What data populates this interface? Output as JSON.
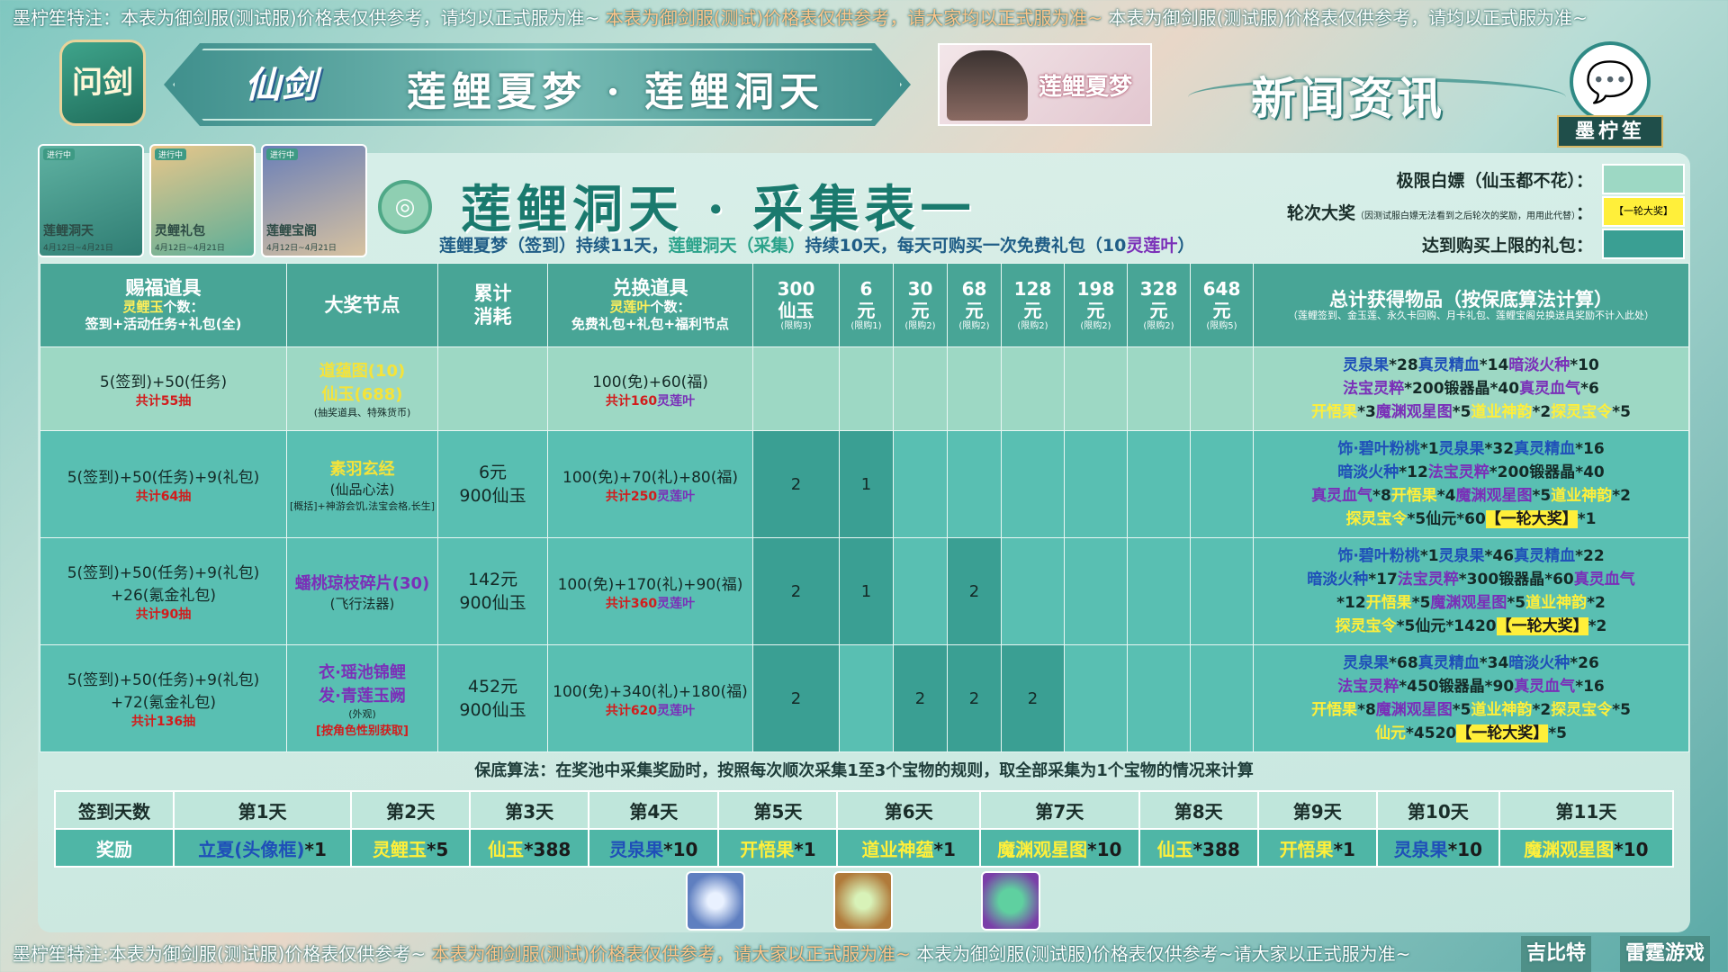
{
  "top_notice": {
    "part1": "墨柠笙特注：本表为御剑服(测试服)价格表仅供参考，请均以正式服为准~",
    "part2": "本表为御剑服(测试)价格表仅供参考，请大家均以正式服为准~",
    "part3": "本表为御剑服(测试服)价格表仅供参考，请均以正式服为准~"
  },
  "bottom_notice": {
    "part1": "墨柠笙特注:本表为御剑服(测试服)价格表仅供参考~",
    "part2": "本表为御剑服(测试)价格表仅供参考，请大家以正式服为准~",
    "part3": "本表为御剑服(测试服)价格表仅供参考~请大家以正式服为准~"
  },
  "header": {
    "game_logo": "问剑",
    "brand": "仙剑",
    "banner_title": "莲鲤夏梦 · 莲鲤洞天",
    "promo_text": "莲鲤夏梦",
    "news_title": "新闻资讯",
    "author_plate": "墨柠笙",
    "wechat_icon": "wechat-icon"
  },
  "cards": [
    {
      "tag": "进行中",
      "name": "莲鲤洞天",
      "date": "4月12日~4月21日"
    },
    {
      "tag": "进行中",
      "name": "灵鲤礼包",
      "date": "4月12日~4月21日"
    },
    {
      "tag": "进行中",
      "name": "莲鲤宝阁",
      "date": "4月12日~4月21日"
    }
  ],
  "sheet": {
    "title": "莲鲤洞天 · 采集表一",
    "subline_a": "莲鲤夏梦（签到）持续11天，",
    "subline_b": "莲鲤洞天（采集）",
    "subline_c": "持续10天，每天可购买一次免费礼包（10",
    "subline_d": "灵莲叶",
    "subline_e": "）"
  },
  "legend": [
    {
      "label": "极限白嫖（仙玉都不花）：",
      "note": "",
      "swatch_text": "",
      "color": "#9dd8c4"
    },
    {
      "label": "轮次大奖",
      "note": "（因测试服白嫖无法看到之后轮次的奖励，用用此代替）",
      "swatch_text": "【一轮大奖】",
      "color": "#ffef3a"
    },
    {
      "label": "达到购买上限的礼包：",
      "note": "",
      "swatch_text": "",
      "color": "#3a9f93"
    }
  ],
  "table": {
    "headers": {
      "c1": {
        "title": "赐福道具",
        "sub_y": "灵鲤玉",
        "sub": "个数：",
        "sub2": "签到+活动任务+礼包(全)"
      },
      "c2": "大奖节点",
      "c3a": "累计",
      "c3b": "消耗",
      "c4": {
        "title": "兑换道具",
        "sub_y": "灵莲叶",
        "sub": "个数：",
        "sub2": "免费礼包+礼包+福利节点"
      },
      "packs": [
        {
          "a": "300",
          "b": "仙玉",
          "c": "(限购3)"
        },
        {
          "a": "6",
          "b": "元",
          "c": "(限购1)"
        },
        {
          "a": "30",
          "b": "元",
          "c": "(限购2)"
        },
        {
          "a": "68",
          "b": "元",
          "c": "(限购2)"
        },
        {
          "a": "128",
          "b": "元",
          "c": "(限购2)"
        },
        {
          "a": "198",
          "b": "元",
          "c": "(限购2)"
        },
        {
          "a": "328",
          "b": "元",
          "c": "(限购2)"
        },
        {
          "a": "648",
          "b": "元",
          "c": "(限购5)"
        }
      ],
      "total_title": "总计获得物品（按保底算法计算）",
      "total_note": "（莲鲤签到、金玉莲、永久卡回购、月卡礼包、莲鲤宝阁兑换送具奖励不计入此处）"
    },
    "rows": [
      {
        "c1": "5(签到)+50(任务)",
        "c1b": "",
        "c1_total": "共计55抽",
        "c2": "道蕴图(10)",
        "c2b": "仙玉(688)",
        "c2c": "(抽奖道具、特殊货币)",
        "c3a": "",
        "c3b": "",
        "c4": "100(免)+60(福)",
        "c4_total_a": "共计160",
        "c4_total_b": "灵莲叶",
        "packs": [
          "",
          "",
          "",
          "",
          "",
          "",
          "",
          ""
        ],
        "totals": [
          [
            [
              "b",
              "灵泉果"
            ],
            [
              "n",
              "*28"
            ],
            [
              "b",
              "真灵精血"
            ],
            [
              "n",
              "*14"
            ],
            [
              "p",
              "暗淡火种"
            ],
            [
              "n",
              "*10"
            ]
          ],
          [
            [
              "p",
              "法宝灵粹"
            ],
            [
              "n",
              "*200"
            ],
            [
              "n",
              "锻器晶"
            ],
            [
              "n",
              "*40"
            ],
            [
              "p",
              "真灵血气"
            ],
            [
              "n",
              "*6"
            ]
          ],
          [
            [
              "y",
              "开悟果"
            ],
            [
              "n",
              "*3"
            ],
            [
              "p",
              "魔渊观星图"
            ],
            [
              "n",
              "*5"
            ],
            [
              "y",
              "道业神韵"
            ],
            [
              "n",
              "*2"
            ],
            [
              "y",
              "探灵宝令"
            ],
            [
              "n",
              "*5"
            ]
          ]
        ]
      },
      {
        "c1": "5(签到)+50(任务)+9(礼包)",
        "c1b": "",
        "c1_total": "共计64抽",
        "c2": "素羽玄经",
        "c2b": "(仙品心法)",
        "c2c": "[概括]+神游会饥,法宝会格,长生]",
        "c3a": "6元",
        "c3b": "900仙玉",
        "c4": "100(免)+70(礼)+80(福)",
        "c4_total_a": "共计250",
        "c4_total_b": "灵莲叶",
        "packs": [
          "2",
          "1",
          "",
          "",
          "",
          "",
          "",
          ""
        ],
        "totals": [
          [
            [
              "b",
              "饰·碧叶粉桃"
            ],
            [
              "n",
              "*1"
            ],
            [
              "b",
              "灵泉果"
            ],
            [
              "n",
              "*32"
            ],
            [
              "b",
              "真灵精血"
            ],
            [
              "n",
              "*16"
            ]
          ],
          [
            [
              "b",
              "暗淡火种"
            ],
            [
              "n",
              "*12"
            ],
            [
              "p",
              "法宝灵粹"
            ],
            [
              "n",
              "*200"
            ],
            [
              "n",
              "锻器晶"
            ],
            [
              "n",
              "*40"
            ]
          ],
          [
            [
              "p",
              "真灵血气"
            ],
            [
              "n",
              "*8"
            ],
            [
              "y",
              "开悟果"
            ],
            [
              "n",
              "*4"
            ],
            [
              "p",
              "魔渊观星图"
            ],
            [
              "n",
              "*5"
            ],
            [
              "y",
              "道业神韵"
            ],
            [
              "n",
              "*2"
            ]
          ],
          [
            [
              "y",
              "探灵宝令"
            ],
            [
              "n",
              "*5"
            ],
            [
              "n",
              "仙元"
            ],
            [
              "n",
              "*60"
            ],
            [
              "hl",
              "【一轮大奖】"
            ],
            [
              "n",
              "*1"
            ]
          ]
        ]
      },
      {
        "c1": "5(签到)+50(任务)+9(礼包)",
        "c1b": "+26(氪金礼包)",
        "c1_total": "共计90抽",
        "c2": "蟠桃琼枝碎片(30)",
        "c2b": "(飞行法器)",
        "c2c": "",
        "c3a": "142元",
        "c3b": "900仙玉",
        "c4": "100(免)+170(礼)+90(福)",
        "c4_total_a": "共计360",
        "c4_total_b": "灵莲叶",
        "packs": [
          "2",
          "1",
          "",
          "2",
          "",
          "",
          "",
          ""
        ],
        "totals": [
          [
            [
              "b",
              "饰·碧叶粉桃"
            ],
            [
              "n",
              "*1"
            ],
            [
              "b",
              "灵泉果"
            ],
            [
              "n",
              "*46"
            ],
            [
              "b",
              "真灵精血"
            ],
            [
              "n",
              "*22"
            ]
          ],
          [
            [
              "b",
              "暗淡火种"
            ],
            [
              "n",
              "*17"
            ],
            [
              "p",
              "法宝灵粹"
            ],
            [
              "n",
              "*300"
            ],
            [
              "n",
              "锻器晶"
            ],
            [
              "n",
              "*60"
            ],
            [
              "p",
              "真灵血气"
            ]
          ],
          [
            [
              "n",
              "*12"
            ],
            [
              "y",
              "开悟果"
            ],
            [
              "n",
              "*5"
            ],
            [
              "p",
              "魔渊观星图"
            ],
            [
              "n",
              "*5"
            ],
            [
              "y",
              "道业神韵"
            ],
            [
              "n",
              "*2"
            ]
          ],
          [
            [
              "y",
              "探灵宝令"
            ],
            [
              "n",
              "*5"
            ],
            [
              "n",
              "仙元"
            ],
            [
              "n",
              "*1420"
            ],
            [
              "hl",
              "【一轮大奖】"
            ],
            [
              "n",
              "*2"
            ]
          ]
        ]
      },
      {
        "c1": "5(签到)+50(任务)+9(礼包)",
        "c1b": "+72(氪金礼包)",
        "c1_total": "共计136抽",
        "c2": "衣·瑶池锦鲤",
        "c2b": "发·青莲玉阙",
        "c2c": "(外观)",
        "c2d": "[按角色性别获取]",
        "c3a": "452元",
        "c3b": "900仙玉",
        "c4": "100(免)+340(礼)+180(福)",
        "c4_total_a": "共计620",
        "c4_total_b": "灵莲叶",
        "packs": [
          "2",
          "",
          "2",
          "2",
          "2",
          "",
          "",
          ""
        ],
        "totals": [
          [
            [
              "b",
              "灵泉果"
            ],
            [
              "n",
              "*68"
            ],
            [
              "b",
              "真灵精血"
            ],
            [
              "n",
              "*34"
            ],
            [
              "b",
              "暗淡火种"
            ],
            [
              "n",
              "*26"
            ]
          ],
          [
            [
              "p",
              "法宝灵粹"
            ],
            [
              "n",
              "*450"
            ],
            [
              "n",
              "锻器晶"
            ],
            [
              "n",
              "*90"
            ],
            [
              "p",
              "真灵血气"
            ],
            [
              "n",
              "*16"
            ]
          ],
          [
            [
              "y",
              "开悟果"
            ],
            [
              "n",
              "*8"
            ],
            [
              "p",
              "魔渊观星图"
            ],
            [
              "n",
              "*5"
            ],
            [
              "y",
              "道业神韵"
            ],
            [
              "n",
              "*2"
            ],
            [
              "y",
              "探灵宝令"
            ],
            [
              "n",
              "*5"
            ]
          ],
          [
            [
              "y",
              "仙元"
            ],
            [
              "n",
              "*4520"
            ],
            [
              "hl",
              "【一轮大奖】"
            ],
            [
              "n",
              "*5"
            ]
          ]
        ]
      }
    ]
  },
  "rule": "保底算法：在奖池中采集奖励时，按照每次顺次采集1至3个宝物的规则，取全部采集为1个宝物的情况来计算",
  "signin": {
    "head_label": "签到天数",
    "reward_label": "奖励",
    "days": [
      "第1天",
      "第2天",
      "第3天",
      "第4天",
      "第5天",
      "第6天",
      "第7天",
      "第8天",
      "第9天",
      "第10天",
      "第11天"
    ],
    "rewards": [
      {
        "item": "立夏(头像框)",
        "qty": "*1",
        "color": "b"
      },
      {
        "item": "灵鲤玉",
        "qty": "*5",
        "color": "y"
      },
      {
        "item": "仙玉",
        "qty": "*388",
        "color": "y"
      },
      {
        "item": "灵泉果",
        "qty": "*10",
        "color": "b"
      },
      {
        "item": "开悟果",
        "qty": "*1",
        "color": "y"
      },
      {
        "item": "道业神蕴",
        "qty": "*1",
        "color": "y"
      },
      {
        "item": "魔渊观星图",
        "qty": "*10",
        "color": "y"
      },
      {
        "item": "仙玉",
        "qty": "*388",
        "color": "y"
      },
      {
        "item": "开悟果",
        "qty": "*1",
        "color": "y"
      },
      {
        "item": "灵泉果",
        "qty": "*10",
        "color": "b"
      },
      {
        "item": "魔渊观星图",
        "qty": "*10",
        "color": "y"
      }
    ]
  },
  "bottom_brands": {
    "a": "吉比特",
    "b": "雷霆游戏"
  }
}
